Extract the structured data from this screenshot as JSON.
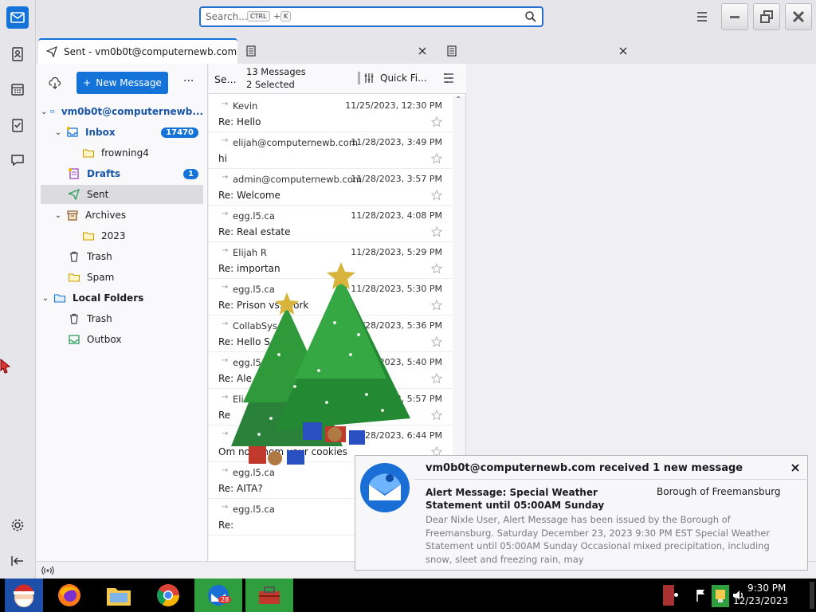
{
  "search": {
    "placeholder": "Search...",
    "shortcut_ctrl": "CTRL",
    "shortcut_plus": "+",
    "shortcut_key": "K"
  },
  "tabs": [
    {
      "label": "Sent - vm0b0t@computernewb.com"
    }
  ],
  "folder_pane": {
    "new_message_label": "New Message",
    "account": "vm0b0t@computernewb...",
    "folders": [
      {
        "label": "Inbox",
        "count": "17470"
      },
      {
        "label": "frowning4"
      },
      {
        "label": "Drafts",
        "count": "1"
      },
      {
        "label": "Sent"
      },
      {
        "label": "Archives"
      },
      {
        "label": "2023"
      },
      {
        "label": "Trash"
      },
      {
        "label": "Spam"
      }
    ],
    "local_folders": "Local Folders",
    "local": [
      {
        "label": "Trash"
      },
      {
        "label": "Outbox"
      }
    ]
  },
  "list": {
    "folder_short": "Se...",
    "message_count": "13 Messages",
    "selected_count": "2 Selected",
    "quick_filter": "Quick Fi...",
    "messages": [
      {
        "from": "Kevin",
        "date": "11/25/2023, 12:30 PM",
        "subject": "Re: Hello"
      },
      {
        "from": "elijah@computernewb.com",
        "date": "11/28/2023, 3:49 PM",
        "subject": "hi"
      },
      {
        "from": "admin@computernewb.com",
        "date": "11/28/2023, 3:57 PM",
        "subject": "Re: Welcome"
      },
      {
        "from": "egg.l5.ca",
        "date": "11/28/2023, 4:08 PM",
        "subject": "Re: Real estate"
      },
      {
        "from": "Elijah R",
        "date": "11/28/2023, 5:29 PM",
        "subject": "Re: importan"
      },
      {
        "from": "egg.l5.ca",
        "date": "11/28/2023, 5:30 PM",
        "subject": "Re: Prison vs. work"
      },
      {
        "from": "CollabSys",
        "date": "11/28/2023, 5:36 PM",
        "subject": "Re: Hello S"
      },
      {
        "from": "egg.l5.ca",
        "date": "11/28/2023, 5:40 PM",
        "subject": "Re: Ale"
      },
      {
        "from": "Eli",
        "date": "11/28/2023, 5:57 PM",
        "subject": "Re"
      },
      {
        "from": "",
        "date": "11/28/2023, 6:44 PM",
        "subject": "Om nom nom your cookies"
      },
      {
        "from": "egg.l5.ca",
        "date": "",
        "subject": "Re: AITA?"
      },
      {
        "from": "egg.l5.ca",
        "date": "",
        "subject": "Re:"
      }
    ]
  },
  "notification": {
    "title": "vm0b0t@computernewb.com received 1 new message",
    "subject": "Alert Message: Special Weather Statement until 05:00AM Sunday",
    "sender": "Borough of Freemansburg",
    "body": "Dear Nixle User, Alert Message has been issued by the Borough of Freemansburg. Saturday December 23, 2023 9:30 PM EST Special Weather Statement until 05:00AM Sunday Occasional mixed precipitation, including snow, sleet and freezing rain, may"
  },
  "taskbar": {
    "thunderbird_badge": "28",
    "time": "9:30 PM",
    "date": "12/23/2023"
  },
  "colors": {
    "accent": "#1373d9",
    "badge": "#1373d9"
  }
}
